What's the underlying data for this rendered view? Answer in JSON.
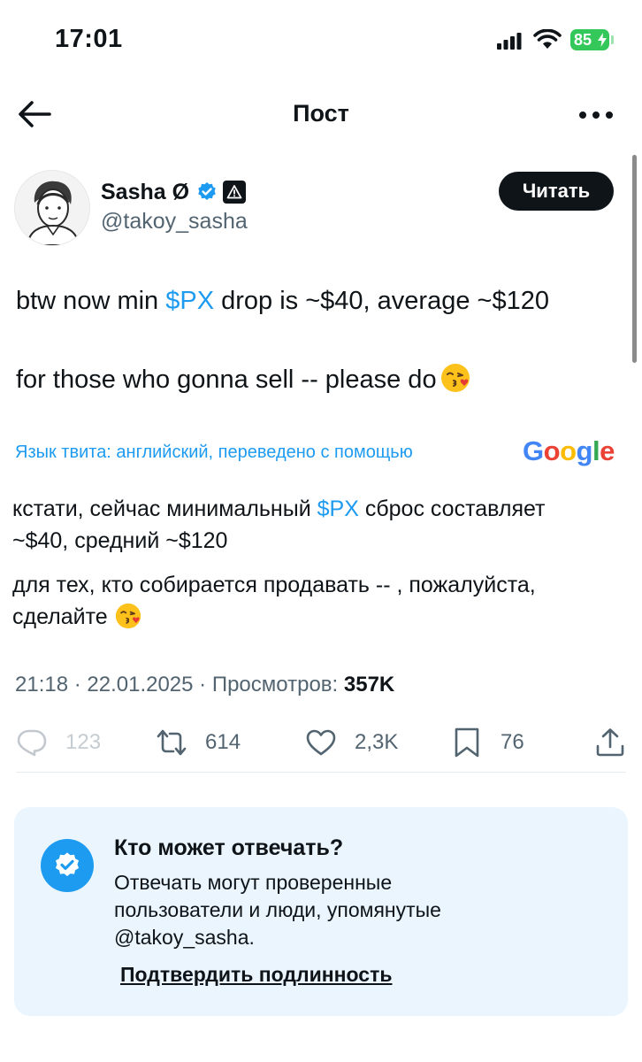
{
  "status_bar": {
    "time": "17:01",
    "battery_level": "85"
  },
  "nav": {
    "title": "Пост"
  },
  "author": {
    "name": "Sasha Ø",
    "handle": "@takoy_sasha",
    "follow_label": "Читать"
  },
  "tweet": {
    "line1_before": "btw now min ",
    "line1_cashtag": "$PX",
    "line1_after": " drop is ~$40, average ~$120",
    "line2": "for those who gonna sell -- please do"
  },
  "translation": {
    "note": "Язык твита: английский, переведено с помощью",
    "provider": "Google",
    "line1_before": "кстати, сейчас минимальный ",
    "line1_cashtag": "$PX",
    "line1_after": " сброс составляет",
    "line2": "~$40, средний ~$120",
    "line3": "для тех, кто собирается продавать -- , пожалуйста,",
    "line4": "сделайте"
  },
  "meta": {
    "time_date": "21:18 · 22.01.2025 · Просмотров: ",
    "views": "357K"
  },
  "actions": {
    "replies": "123",
    "reposts": "614",
    "likes": "2,3K",
    "bookmarks": "76"
  },
  "reply_restriction": {
    "title": "Кто может отвечать?",
    "desc_line1": "Отвечать могут проверенные",
    "desc_line2": "пользователи и люди, упомянутые",
    "desc_line3": "@takoy_sasha.",
    "link": "Подтвердить подлинность"
  },
  "colors": {
    "accent": "#1d9bf0",
    "text": "#0f1419",
    "muted": "#536471",
    "card_bg": "#eaf5fd",
    "battery": "#34c759"
  }
}
